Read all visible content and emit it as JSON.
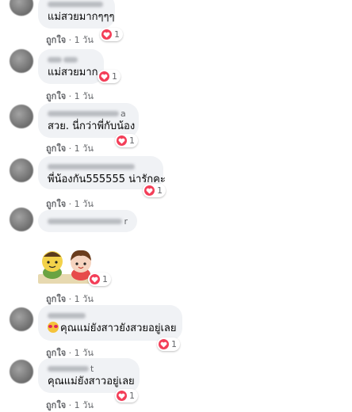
{
  "comments": [
    {
      "text": "แม่สวยมากๆๆๆ",
      "like": "ถูกใจ",
      "time": "1 วัน",
      "reactions": "1",
      "name_suffix": ""
    },
    {
      "text": "แม่สวยมาก",
      "like": "ถูกใจ",
      "time": "1 วัน",
      "reactions": "1",
      "name_suffix": ""
    },
    {
      "text": "สวย. นี่กว่าพี่กับน้อง",
      "like": "ถูกใจ",
      "time": "1 วัน",
      "reactions": "1",
      "name_suffix": "a"
    },
    {
      "text": "พี่น้องกัน555555 น่ารักคะ",
      "like": "ถูกใจ",
      "time": "1 วัน",
      "reactions": "1",
      "name_suffix": ""
    },
    {
      "text": "",
      "like": "ถูกใจ",
      "time": "1 วัน",
      "reactions": "1",
      "name_suffix": "r",
      "sticker": "two-kids-sticker"
    },
    {
      "text": "คุณแม่ยังสาวยังสวยอยู่เลย",
      "like": "ถูกใจ",
      "time": "1 วัน",
      "reactions": "1",
      "name_suffix": "",
      "emoji": "heart-eyes-emoji"
    },
    {
      "text": "คุณแม่ยังสาวอยู่เลย",
      "like": "ถูกใจ",
      "time": "1 วัน",
      "reactions": "1",
      "name_suffix": "t"
    }
  ],
  "separator": "·",
  "colors": {
    "bubble": "#f0f2f5",
    "heart": "#f33e58",
    "meta": "#65676b"
  },
  "icons": {
    "reaction": "heart-icon"
  }
}
